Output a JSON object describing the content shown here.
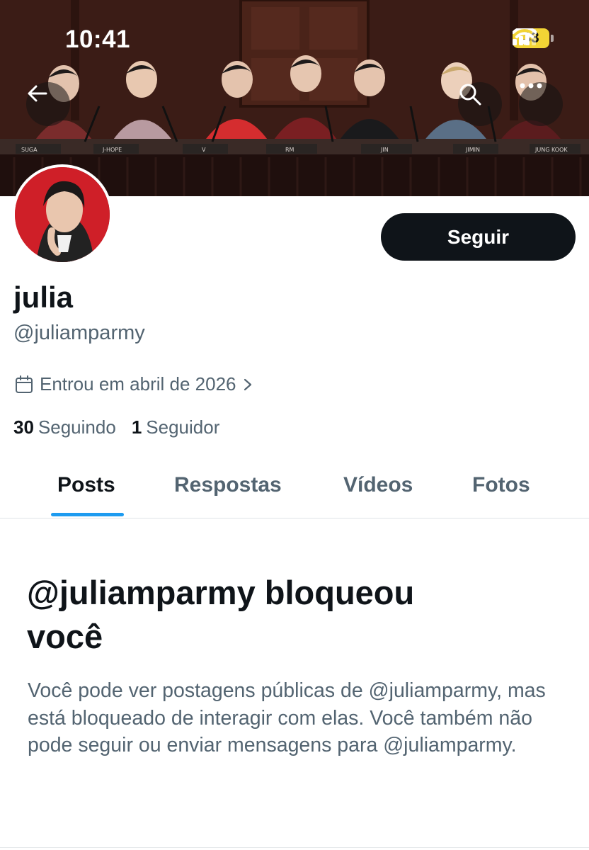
{
  "status_bar": {
    "time": "10:41",
    "battery": "33",
    "battery_color": "#f2d435"
  },
  "header": {
    "back_icon": "arrow-left-icon",
    "search_icon": "search-icon",
    "more_icon": "more-dots-icon",
    "banner_name_plates": [
      "SUGA",
      "J-HOPE",
      "V",
      "RM",
      "JIN",
      "JIMIN",
      "JUNG KOOK"
    ]
  },
  "profile": {
    "follow_label": "Seguir",
    "display_name": "julia",
    "handle": "@juliamparmy",
    "joined": "Entrou em abril de 2026",
    "following_count": "30",
    "following_label": "Seguindo",
    "followers_count": "1",
    "followers_label": "Seguidor"
  },
  "tabs": [
    {
      "label": "Posts",
      "active": true
    },
    {
      "label": "Respostas",
      "active": false
    },
    {
      "label": "Vídeos",
      "active": false
    },
    {
      "label": "Fotos",
      "active": false
    }
  ],
  "blocked": {
    "title_line1": "@juliamparmy bloqueou",
    "title_line2": "você",
    "description": "Você pode ver postagens públicas de @juliamparmy, mas está bloqueado de interagir com elas. Você também não pode seguir ou enviar mensagens para @juliamparmy."
  },
  "colors": {
    "accent": "#1d9bf0",
    "text_primary": "#0f1419",
    "text_secondary": "#536471"
  }
}
